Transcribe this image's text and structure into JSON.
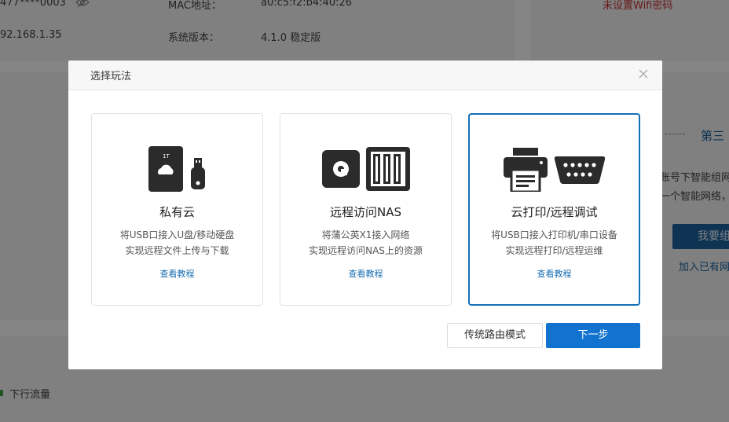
{
  "background": {
    "device_id": "477****0003",
    "ip": "92.168.1.35",
    "mac_label": "MAC地址：",
    "mac_value": "a0:c5:f2:b4:40:26",
    "version_label": "系统版本：",
    "version_value": "4.1.0 稳定版",
    "wifi_warning": "未设置Wifi密码",
    "step_label": "第三",
    "side_text_1": "账号下智能组网",
    "side_text_2": "一个智能网络，",
    "side_button": "我要组",
    "side_link": "加入已有网",
    "traffic_label": "下行流量"
  },
  "modal": {
    "title": "选择玩法",
    "cards": [
      {
        "title": "私有云",
        "desc_line1": "将USB口接入U盘/移动硬盘",
        "desc_line2": "实现远程文件上传与下载",
        "link": "查看教程",
        "icon_badge": "1T"
      },
      {
        "title": "远程访问NAS",
        "desc_line1": "将蒲公英X1接入网络",
        "desc_line2": "实现远程访问NAS上的资源",
        "link": "查看教程"
      },
      {
        "title": "云打印/远程调试",
        "desc_line1": "将USB口接入打印机/串口设备",
        "desc_line2": "实现远程打印/远程运维",
        "link": "查看教程"
      }
    ],
    "legacy_button": "传统路由模式",
    "next_button": "下一步"
  },
  "colors": {
    "accent": "#1173cf",
    "selected_border": "#1570b6",
    "link": "#1a6fb2"
  }
}
